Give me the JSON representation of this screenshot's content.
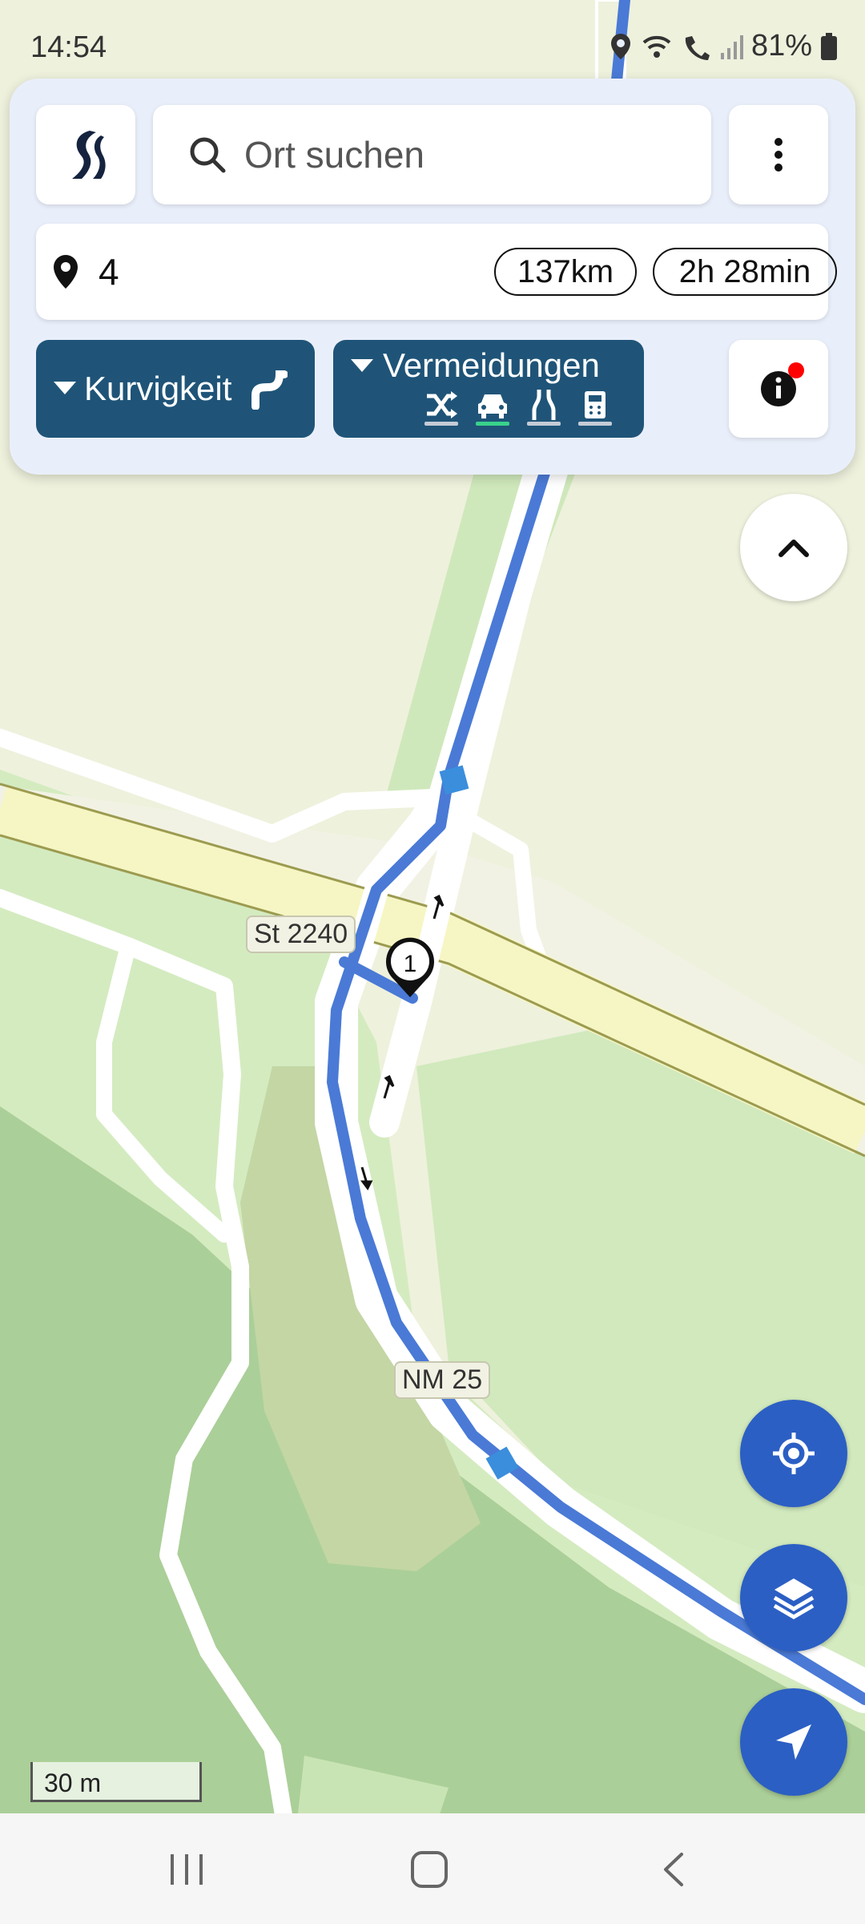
{
  "status_bar": {
    "time": "14:54",
    "battery": "81%"
  },
  "search": {
    "placeholder": "Ort suchen"
  },
  "route": {
    "name": "4",
    "distance": "137km",
    "duration": "2h 28min"
  },
  "buttons": {
    "curviness": "Kurvigkeit",
    "avoidances": "Vermeidungen"
  },
  "avoid_options": [
    {
      "icon": "shuffle-icon",
      "active": false
    },
    {
      "icon": "car-icon",
      "active": true
    },
    {
      "icon": "road-icon",
      "active": false
    },
    {
      "icon": "toll-icon",
      "active": false
    }
  ],
  "map": {
    "road_labels": {
      "st": "St 2240",
      "nm": "NM 25"
    },
    "waypoint": "1",
    "scale": "30 m"
  },
  "colors": {
    "accent": "#1f5478",
    "fab": "#2b5fc4",
    "route": "#4a7ad6"
  }
}
